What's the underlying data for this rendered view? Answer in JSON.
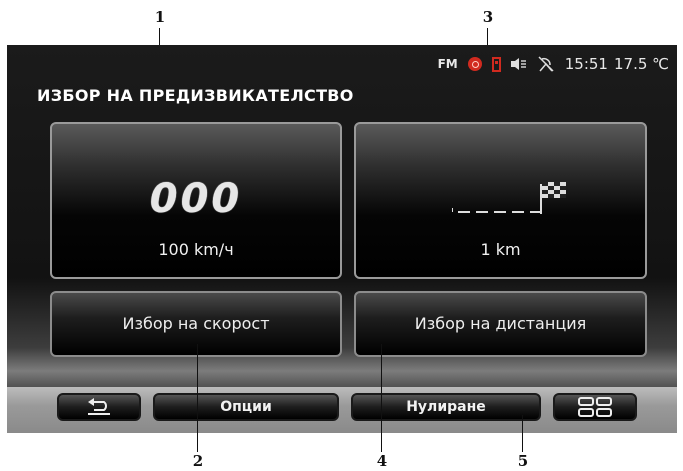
{
  "callouts": [
    "1",
    "2",
    "3",
    "4",
    "5"
  ],
  "status_bar": {
    "radio_band": "FM",
    "time": "15:51",
    "temperature": "17.5 ℃",
    "icons": [
      "red-circle-icon",
      "red-battery-icon",
      "speaker-icon",
      "satellite-icon"
    ],
    "accent_color": "#d12a1f"
  },
  "page_title": "ИЗБОР НА ПРЕДИЗВИКАТЕЛСТВО",
  "speed_tile": {
    "digits": "000",
    "value": "100 km/ч"
  },
  "distance_tile": {
    "value": "1 km"
  },
  "select_speed_label": "Избор на скорост",
  "select_distance_label": "Избор на дистанция",
  "bottom_bar": {
    "back_icon": "back-arrow-icon",
    "options_label": "Опции",
    "reset_label": "Нулиране",
    "menu_icon": "grid-menu-icon"
  }
}
